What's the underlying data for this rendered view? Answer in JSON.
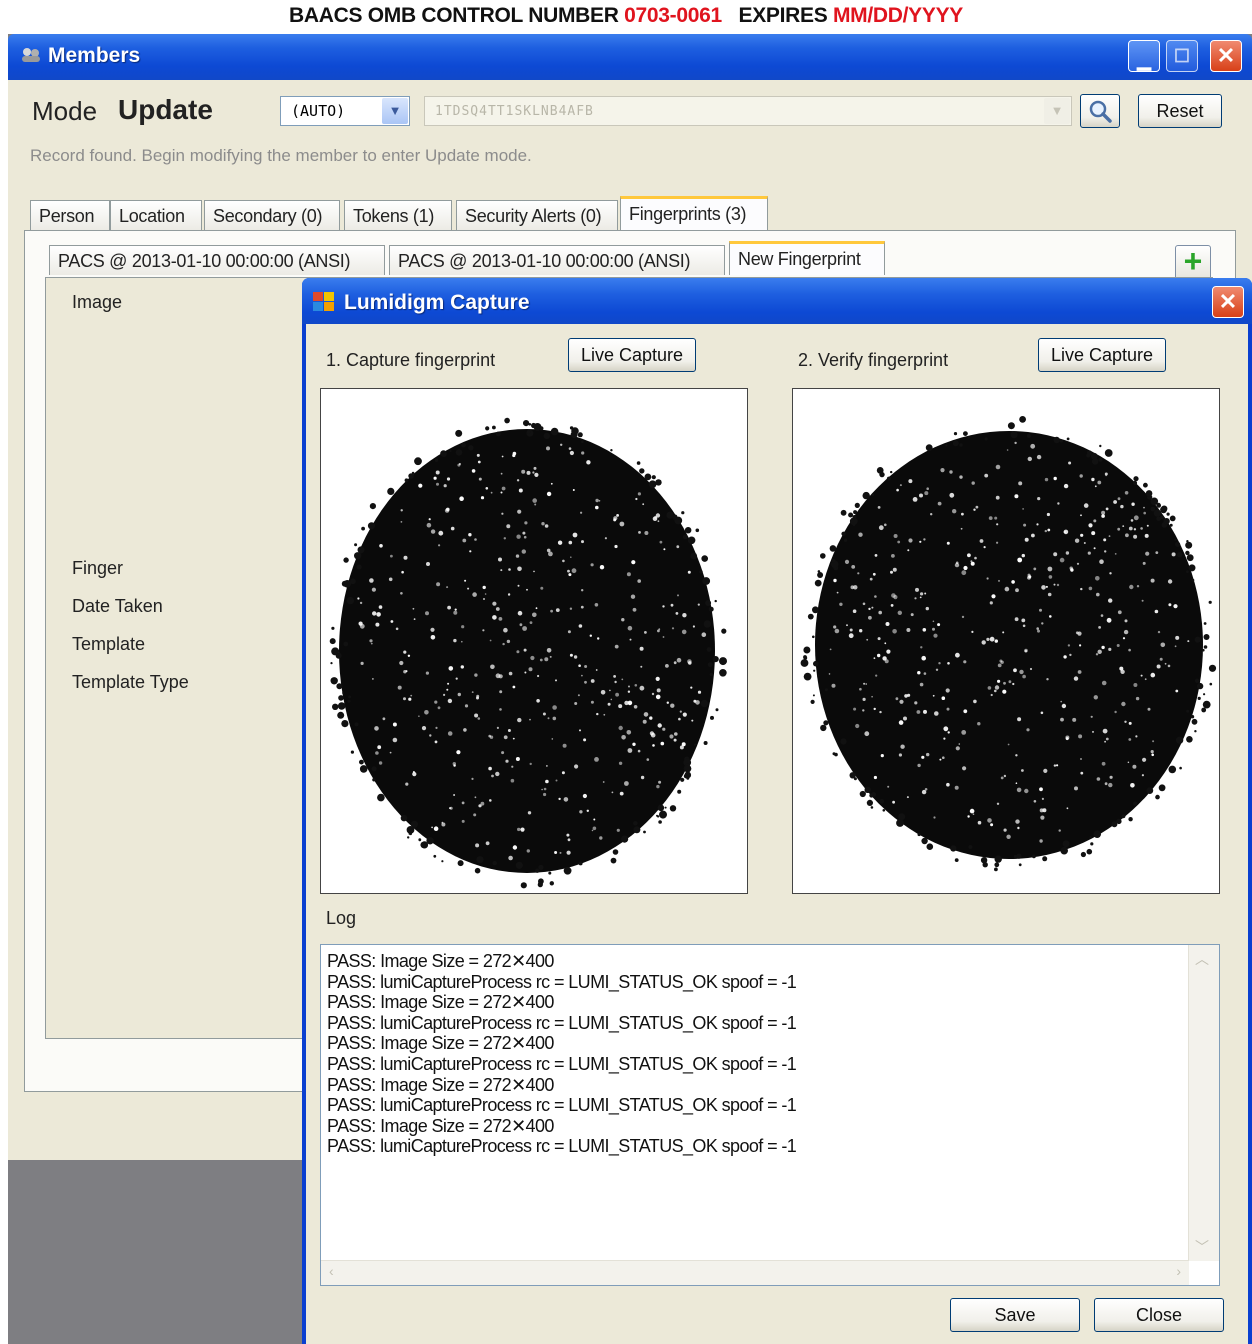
{
  "omb_header": {
    "prefix": "BAACS OMB CONTROL NUMBER",
    "number": "0703-0061",
    "expires_label": "EXPIRES",
    "expires_value": "MM/DD/YYYY"
  },
  "members_window": {
    "title": "Members",
    "mode_label": "Mode",
    "mode_value": "Update",
    "auto_combo_value": "(AUTO)",
    "record_id_value": "1TDSQ4TT1SKLNB4AFB",
    "reset_label": "Reset",
    "status_message": "Record found. Begin modifying the member to enter Update mode.",
    "tabs": [
      {
        "label": "Person"
      },
      {
        "label": "Location"
      },
      {
        "label": "Secondary (0)"
      },
      {
        "label": "Tokens (1)"
      },
      {
        "label": "Security Alerts (0)"
      },
      {
        "label": "Fingerprints (3)"
      }
    ],
    "fingerprint_tabs": [
      {
        "label": "PACS @ 2013-01-10 00:00:00 (ANSI)"
      },
      {
        "label": "PACS @ 2013-01-10 00:00:00 (ANSI)"
      },
      {
        "label": "New Fingerprint"
      }
    ],
    "fields": {
      "image": "Image",
      "finger": "Finger",
      "date_taken": "Date Taken",
      "template": "Template",
      "template_type": "Template Type"
    }
  },
  "capture_dialog": {
    "title": "Lumidigm Capture",
    "step1_label": "1. Capture fingerprint",
    "step2_label": "2. Verify fingerprint",
    "live_capture_label": "Live Capture",
    "log_label": "Log",
    "log_lines": [
      "PASS: Image Size = 272✕400",
      "PASS: lumiCaptureProcess rc = LUMI_STATUS_OK spoof = -1",
      "PASS: Image Size = 272✕400",
      "PASS: lumiCaptureProcess rc = LUMI_STATUS_OK spoof = -1",
      "PASS: Image Size = 272✕400",
      "PASS: lumiCaptureProcess rc = LUMI_STATUS_OK spoof = -1",
      "PASS: Image Size = 272✕400",
      "PASS: lumiCaptureProcess rc = LUMI_STATUS_OK spoof = -1",
      "PASS: Image Size = 272✕400",
      "PASS: lumiCaptureProcess rc = LUMI_STATUS_OK spoof = -1"
    ],
    "save_label": "Save",
    "close_label": "Close"
  },
  "colors": {
    "xp_title_blue": "#0d49d4",
    "omb_red": "#e0141e",
    "tab_active_accent": "#ffc83c"
  }
}
